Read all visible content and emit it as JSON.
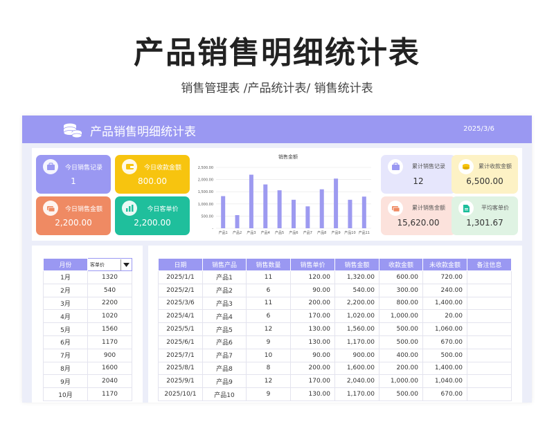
{
  "page": {
    "title": "产品销售明细统计表",
    "subtitle": "销售管理表 /产品统计表/ 销售统计表"
  },
  "banner": {
    "title": "产品销售明细统计表",
    "date": "2025/3/6"
  },
  "colors": {
    "accent": "#9a98f2",
    "card_purple": "#9a98f2",
    "card_yellow": "#f7c40f",
    "card_orange": "#ef8a63",
    "card_teal": "#1fbf9c",
    "card_light_purple": "#e6e6fc",
    "card_light_yellow": "#fdf2c5",
    "card_light_pink": "#fce2dc",
    "card_light_green": "#dff3e3"
  },
  "cards_left": [
    {
      "label": "今日销售记录",
      "value": "1",
      "icon": "briefcase-icon"
    },
    {
      "label": "今日收款金额",
      "value": "800.00",
      "icon": "wallet-icon"
    },
    {
      "label": "今日销售金额",
      "value": "2,200.00",
      "icon": "money-icon"
    },
    {
      "label": "今日客单价",
      "value": "2,200.00",
      "icon": "bar-chart-icon"
    }
  ],
  "cards_right": [
    {
      "label": "累计销售记录",
      "value": "12",
      "icon": "briefcase-icon"
    },
    {
      "label": "累计收款金额",
      "value": "6,500.00",
      "icon": "coins-icon"
    },
    {
      "label": "累计销售金额",
      "value": "15,620.00",
      "icon": "money-icon"
    },
    {
      "label": "平均客单价",
      "value": "1,301.67",
      "icon": "document-icon"
    }
  ],
  "chart_data": {
    "type": "bar",
    "title": "销售金额",
    "categories": [
      "产品1",
      "产品2",
      "产品3",
      "产品4",
      "产品5",
      "产品6",
      "产品7",
      "产品8",
      "产品9",
      "产品10",
      "产品11"
    ],
    "values": [
      1320,
      540,
      2200,
      1800,
      1560,
      1170,
      900,
      1600,
      2040,
      1170,
      1300
    ],
    "y_ticks": [
      "-",
      "500.00",
      "1,000.00",
      "1,500.00",
      "2,000.00",
      "2,500.00"
    ],
    "ylim": [
      0,
      2500
    ],
    "color": "#9d9af0",
    "grid": true
  },
  "left_table": {
    "headers": [
      "月份"
    ],
    "select_value": "客单价",
    "rows": [
      [
        "1月",
        "1320"
      ],
      [
        "2月",
        "540"
      ],
      [
        "3月",
        "2200"
      ],
      [
        "4月",
        "1020"
      ],
      [
        "5月",
        "1560"
      ],
      [
        "6月",
        "1170"
      ],
      [
        "7月",
        "900"
      ],
      [
        "8月",
        "1600"
      ],
      [
        "9月",
        "2040"
      ],
      [
        "10月",
        "1170"
      ]
    ]
  },
  "right_table": {
    "headers": [
      "日期",
      "销售产品",
      "销售数量",
      "销售单价",
      "销售金额",
      "收款金额",
      "未收款金额",
      "备注信息"
    ],
    "rows": [
      [
        "2025/1/1",
        "产品1",
        "11",
        "120.00",
        "1,320.00",
        "600.00",
        "720.00",
        ""
      ],
      [
        "2025/2/1",
        "产品2",
        "6",
        "90.00",
        "540.00",
        "300.00",
        "240.00",
        ""
      ],
      [
        "2025/3/6",
        "产品3",
        "11",
        "200.00",
        "2,200.00",
        "800.00",
        "1,400.00",
        ""
      ],
      [
        "2025/4/1",
        "产品4",
        "6",
        "170.00",
        "1,020.00",
        "1,000.00",
        "20.00",
        ""
      ],
      [
        "2025/5/1",
        "产品5",
        "12",
        "130.00",
        "1,560.00",
        "500.00",
        "1,060.00",
        ""
      ],
      [
        "2025/6/1",
        "产品6",
        "9",
        "130.00",
        "1,170.00",
        "500.00",
        "670.00",
        ""
      ],
      [
        "2025/7/1",
        "产品7",
        "10",
        "90.00",
        "900.00",
        "400.00",
        "500.00",
        ""
      ],
      [
        "2025/8/1",
        "产品8",
        "8",
        "200.00",
        "1,600.00",
        "200.00",
        "1,400.00",
        ""
      ],
      [
        "2025/9/1",
        "产品9",
        "12",
        "170.00",
        "2,040.00",
        "1,000.00",
        "1,040.00",
        ""
      ],
      [
        "2025/10/1",
        "产品10",
        "9",
        "130.00",
        "1,170.00",
        "500.00",
        "670.00",
        ""
      ]
    ]
  }
}
